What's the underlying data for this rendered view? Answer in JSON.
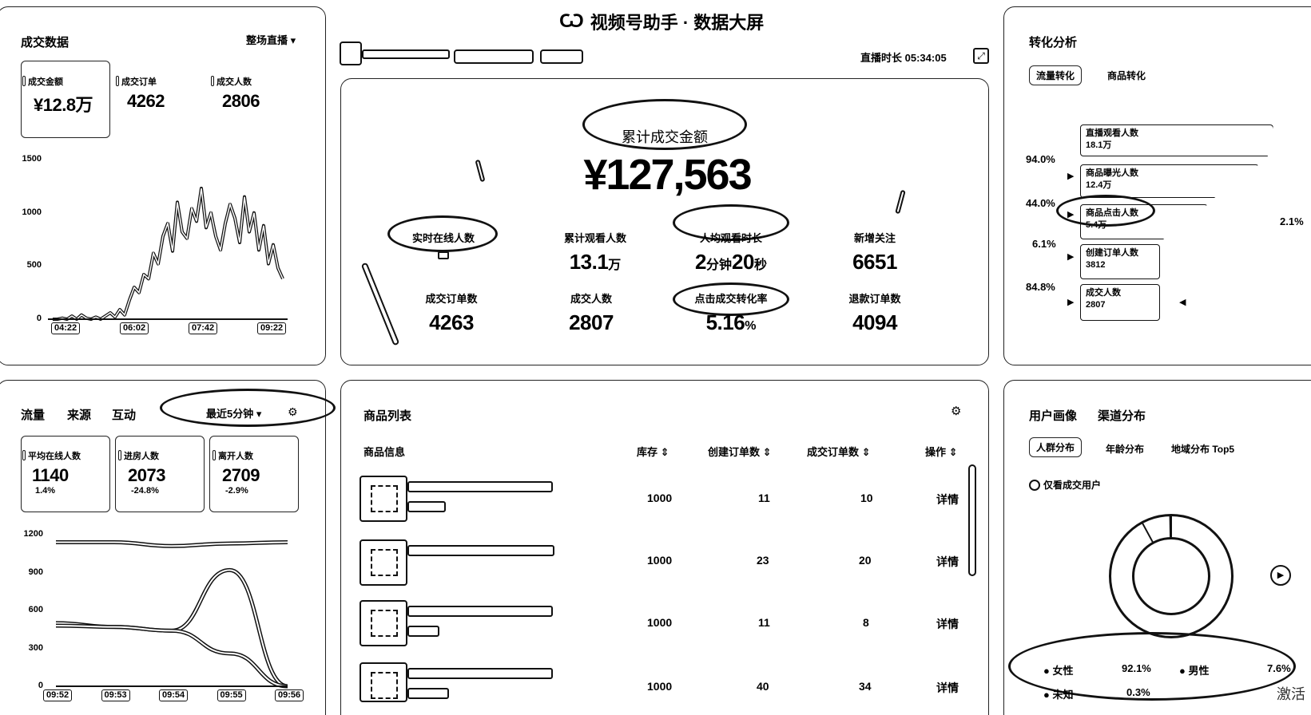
{
  "header": {
    "title": "视频号助手 · 数据大屏",
    "live_duration_label": "直播时长",
    "live_duration": "05:34:05"
  },
  "deal": {
    "title": "成交数据",
    "range": "整场直播",
    "kpis": [
      {
        "label": "成交金额",
        "value": "¥12.8万"
      },
      {
        "label": "成交订单",
        "value": "4262"
      },
      {
        "label": "成交人数",
        "value": "2806"
      }
    ],
    "chart_data": {
      "type": "line",
      "title": "",
      "x_ticks": [
        "04:22",
        "06:02",
        "07:42",
        "09:22"
      ],
      "y_ticks": [
        0,
        500,
        1000,
        1500
      ],
      "ylim": [
        0,
        1500
      ],
      "series": [
        {
          "name": "",
          "values": [
            0,
            0,
            10,
            0,
            30,
            0,
            40,
            10,
            0,
            20,
            0,
            30,
            60,
            20,
            90,
            40,
            180,
            300,
            250,
            420,
            380,
            620,
            520,
            780,
            900,
            640,
            1100,
            820,
            760,
            1040,
            920,
            1230,
            860,
            1000,
            780,
            650,
            900,
            1080,
            950,
            720,
            1150,
            820,
            1000,
            650,
            880,
            520,
            700,
            480,
            380
          ]
        }
      ]
    }
  },
  "center": {
    "total_amount_label": "累计成交金额",
    "total_amount": "¥127,563",
    "stats": [
      {
        "label": "实时在线人数",
        "value": ""
      },
      {
        "label": "累计观看人数",
        "value": "13.1",
        "unit": "万"
      },
      {
        "label": "人均观看时长",
        "value_a": "2",
        "unit_a": "分钟",
        "value_b": "20",
        "unit_b": "秒"
      },
      {
        "label": "新增关注",
        "value": "6651"
      },
      {
        "label": "成交订单数",
        "value": "4263"
      },
      {
        "label": "成交人数",
        "value": "2807"
      },
      {
        "label": "点击成交转化率",
        "value": "5.16",
        "unit": "%"
      },
      {
        "label": "退款订单数",
        "value": "4094"
      }
    ]
  },
  "conversion": {
    "title": "转化分析",
    "tabs": [
      "流量转化",
      "商品转化"
    ],
    "funnel": [
      {
        "label": "直播观看人数",
        "value": "18.1万"
      },
      {
        "label": "商品曝光人数",
        "value": "12.4万"
      },
      {
        "label": "商品点击人数",
        "value": "5.4万"
      },
      {
        "label": "创建订单人数",
        "value": "3812"
      },
      {
        "label": "成交人数",
        "value": "2807"
      }
    ],
    "rates": [
      "94.0%",
      "44.0%",
      "6.1%",
      "84.8%"
    ],
    "side_rate": "2.1%"
  },
  "traffic": {
    "tabs": [
      "流量",
      "来源",
      "互动"
    ],
    "range": "最近5分钟",
    "kpis": [
      {
        "label": "平均在线人数",
        "value": "1140",
        "delta": "1.4%"
      },
      {
        "label": "进房人数",
        "value": "2073",
        "delta": "-24.8%"
      },
      {
        "label": "离开人数",
        "value": "2709",
        "delta": "-2.9%"
      }
    ],
    "chart_data": {
      "type": "line",
      "title": "",
      "x": [
        "09:52",
        "09:53",
        "09:54",
        "09:55",
        "09:56"
      ],
      "y_ticks": [
        0,
        300,
        600,
        900,
        1200
      ],
      "ylim": [
        0,
        1200
      ],
      "series": [
        {
          "name": "",
          "values": [
            1140,
            1140,
            1110,
            1130,
            1140
          ]
        },
        {
          "name": "",
          "values": [
            500,
            470,
            440,
            920,
            0
          ]
        },
        {
          "name": "",
          "values": [
            480,
            470,
            440,
            260,
            0
          ]
        }
      ]
    }
  },
  "products": {
    "title": "商品列表",
    "columns": [
      "商品信息",
      "库存",
      "创建订单数",
      "成交订单数",
      "操作"
    ],
    "rows": [
      {
        "stock": "1000",
        "created": "11",
        "done": "10",
        "action": "详情"
      },
      {
        "stock": "1000",
        "created": "23",
        "done": "20",
        "action": "详情"
      },
      {
        "stock": "1000",
        "created": "11",
        "done": "8",
        "action": "详情"
      },
      {
        "stock": "1000",
        "created": "40",
        "done": "34",
        "action": "详情"
      }
    ]
  },
  "audience": {
    "tabs": [
      "用户画像",
      "渠道分布"
    ],
    "sub_tabs": [
      "人群分布",
      "年龄分布",
      "地域分布 Top5"
    ],
    "filter_label": "仅看成交用户",
    "chart_data": {
      "type": "pie",
      "labels": [
        "女性",
        "男性",
        "未知"
      ],
      "values": [
        92.1,
        7.6,
        0.3
      ]
    },
    "legend": [
      {
        "label": "女性",
        "value": "92.1%"
      },
      {
        "label": "男性",
        "value": "7.6%"
      },
      {
        "label": "未知",
        "value": "0.3%"
      }
    ],
    "watermark": "激活"
  }
}
